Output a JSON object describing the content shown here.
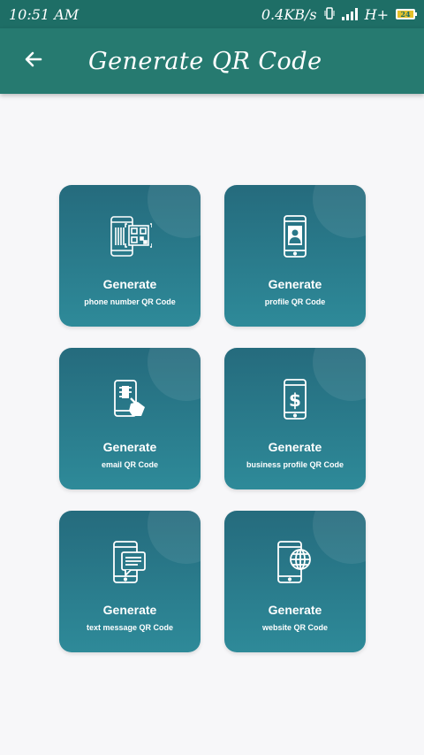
{
  "status_bar": {
    "time": "10:51 AM",
    "network_speed": "0.4KB/s",
    "network_type": "H+",
    "battery": "24"
  },
  "app_bar": {
    "title": "Generate QR Code",
    "back_icon": "arrow-left-icon"
  },
  "cards": [
    {
      "line1": "Generate",
      "line2": "phone number QR Code",
      "icon": "phone-qr-icon"
    },
    {
      "line1": "Generate",
      "line2": "profile QR Code",
      "icon": "phone-profile-icon"
    },
    {
      "line1": "Generate",
      "line2": "email QR Code",
      "icon": "phone-email-icon"
    },
    {
      "line1": "Generate",
      "line2": "business profile QR Code",
      "icon": "phone-dollar-icon"
    },
    {
      "line1": "Generate",
      "line2": "text message QR Code",
      "icon": "phone-message-icon"
    },
    {
      "line1": "Generate",
      "line2": "website QR Code",
      "icon": "phone-globe-icon"
    }
  ],
  "colors": {
    "status_bar": "#1e6e66",
    "app_bar": "#267a70",
    "card_top": "#256b7d",
    "card_bottom": "#2e8a99",
    "background": "#f7f7f9"
  }
}
